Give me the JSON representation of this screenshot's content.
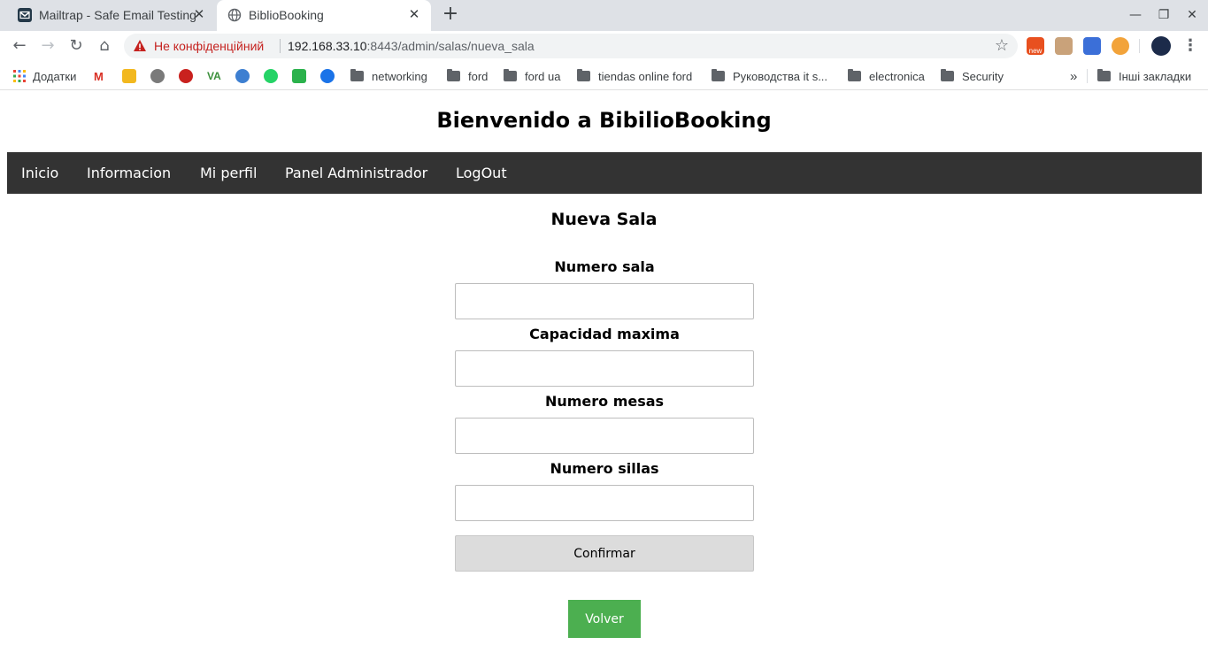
{
  "browser": {
    "tabs": [
      {
        "title": "Mailtrap - Safe Email Testing",
        "icon": "mailtrap-icon",
        "active": false
      },
      {
        "title": "BiblioBooking",
        "icon": "globe-icon",
        "active": true
      }
    ],
    "security_label": "Не конфіденційний",
    "url_host": "192.168.33.10",
    "url_rest": ":8443/admin/salas/nueva_sala",
    "ext_badge": "new",
    "bookmarks": [
      {
        "label": "Додатки",
        "icon": "apps-grid-icon"
      },
      {
        "label": "networking",
        "icon": "folder-icon"
      },
      {
        "label": "ford",
        "icon": "folder-icon"
      },
      {
        "label": "ford ua",
        "icon": "folder-icon"
      },
      {
        "label": "tiendas online ford",
        "icon": "folder-icon"
      },
      {
        "label": "Руководства it s...",
        "icon": "folder-icon"
      },
      {
        "label": "electronica",
        "icon": "folder-icon"
      },
      {
        "label": "Security",
        "icon": "folder-icon"
      }
    ],
    "bookmarks_overflow": "»",
    "other_bookmarks": "Інші закладки"
  },
  "site": {
    "title": "Bienvenido a BibilioBooking",
    "nav": [
      "Inicio",
      "Informacion",
      "Mi perfil",
      "Panel Administrador",
      "LogOut"
    ]
  },
  "form": {
    "heading": "Nueva Sala",
    "fields": [
      {
        "label": "Numero sala",
        "value": ""
      },
      {
        "label": "Capacidad maxima",
        "value": ""
      },
      {
        "label": "Numero mesas",
        "value": ""
      },
      {
        "label": "Numero sillas",
        "value": ""
      }
    ],
    "submit_label": "Confirmar",
    "back_label": "Volver"
  },
  "colors": {
    "navbar_bg": "#333333",
    "back_button": "#4caf50",
    "confirm_button": "#dcdcdc"
  }
}
